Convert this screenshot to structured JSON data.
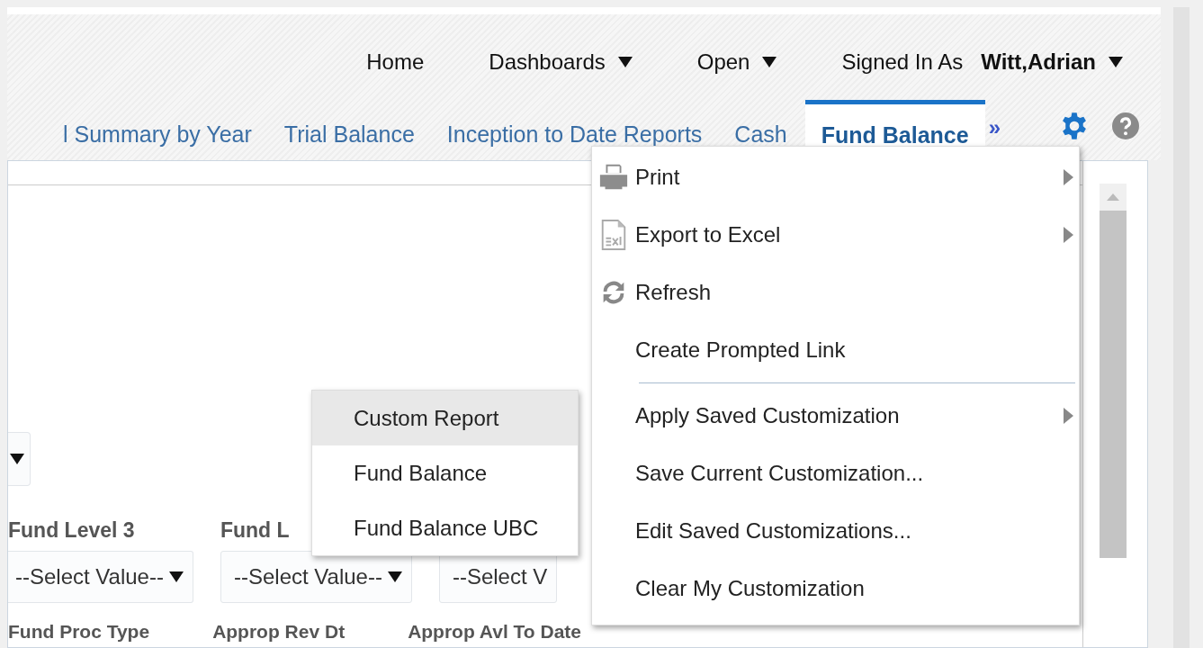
{
  "top_nav": [
    {
      "label": "Home",
      "kind": "link"
    },
    {
      "label": "Dashboards",
      "kind": "dropdown"
    },
    {
      "label": "Open",
      "kind": "dropdown"
    }
  ],
  "user": {
    "prefix": "Signed In As",
    "name": "Witt,Adrian"
  },
  "tabs": [
    {
      "label": "l Summary by Year",
      "selected": false
    },
    {
      "label": "Trial Balance",
      "selected": false
    },
    {
      "label": "Inception to Date Reports",
      "selected": false
    },
    {
      "label": "Cash",
      "selected": false
    },
    {
      "label": "Fund Balance",
      "selected": true
    }
  ],
  "tab_overflow": "»",
  "prompts": [
    {
      "label": "Fund Level 3",
      "value": "--Select Value--"
    },
    {
      "label": "Fund L",
      "value": "--Select Value--"
    },
    {
      "value": "--Select V"
    }
  ],
  "lower_labels": [
    "Fund Proc Type",
    "Approp Rev Dt",
    "Approp Avl To Date"
  ],
  "report_menu": [
    {
      "label": "Custom Report",
      "selected": true
    },
    {
      "label": "Fund Balance",
      "selected": false
    },
    {
      "label": "Fund Balance UBC",
      "selected": false
    }
  ],
  "page_menu": [
    {
      "kind": "print",
      "label": "Print",
      "submenu": true
    },
    {
      "kind": "export",
      "label": "Export to Excel",
      "submenu": true
    },
    {
      "kind": "refresh",
      "label": "Refresh",
      "submenu": false
    },
    {
      "kind": "item",
      "label": "Create Prompted Link",
      "submenu": false
    },
    {
      "kind": "separator"
    },
    {
      "kind": "item",
      "label": "Apply Saved Customization",
      "submenu": true
    },
    {
      "kind": "item",
      "label": "Save Current Customization...",
      "submenu": false
    },
    {
      "kind": "item",
      "label": "Edit Saved Customizations...",
      "submenu": false
    },
    {
      "kind": "item",
      "label": "Clear My Customization",
      "submenu": false
    }
  ]
}
